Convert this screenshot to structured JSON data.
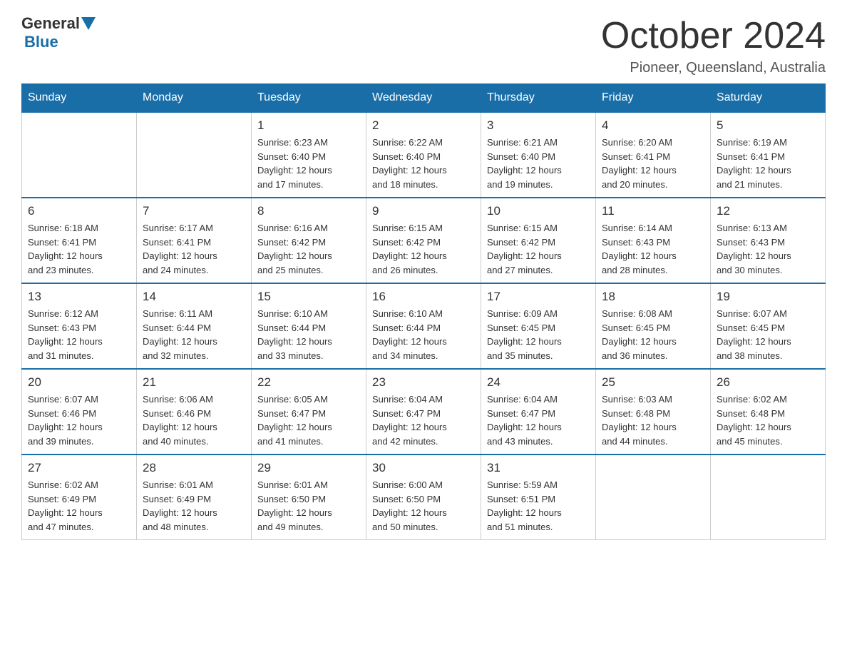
{
  "header": {
    "logo_general": "General",
    "logo_blue": "Blue",
    "month_title": "October 2024",
    "location": "Pioneer, Queensland, Australia"
  },
  "days_of_week": [
    "Sunday",
    "Monday",
    "Tuesday",
    "Wednesday",
    "Thursday",
    "Friday",
    "Saturday"
  ],
  "weeks": [
    [
      {
        "day": "",
        "info": ""
      },
      {
        "day": "",
        "info": ""
      },
      {
        "day": "1",
        "info": "Sunrise: 6:23 AM\nSunset: 6:40 PM\nDaylight: 12 hours\nand 17 minutes."
      },
      {
        "day": "2",
        "info": "Sunrise: 6:22 AM\nSunset: 6:40 PM\nDaylight: 12 hours\nand 18 minutes."
      },
      {
        "day": "3",
        "info": "Sunrise: 6:21 AM\nSunset: 6:40 PM\nDaylight: 12 hours\nand 19 minutes."
      },
      {
        "day": "4",
        "info": "Sunrise: 6:20 AM\nSunset: 6:41 PM\nDaylight: 12 hours\nand 20 minutes."
      },
      {
        "day": "5",
        "info": "Sunrise: 6:19 AM\nSunset: 6:41 PM\nDaylight: 12 hours\nand 21 minutes."
      }
    ],
    [
      {
        "day": "6",
        "info": "Sunrise: 6:18 AM\nSunset: 6:41 PM\nDaylight: 12 hours\nand 23 minutes."
      },
      {
        "day": "7",
        "info": "Sunrise: 6:17 AM\nSunset: 6:41 PM\nDaylight: 12 hours\nand 24 minutes."
      },
      {
        "day": "8",
        "info": "Sunrise: 6:16 AM\nSunset: 6:42 PM\nDaylight: 12 hours\nand 25 minutes."
      },
      {
        "day": "9",
        "info": "Sunrise: 6:15 AM\nSunset: 6:42 PM\nDaylight: 12 hours\nand 26 minutes."
      },
      {
        "day": "10",
        "info": "Sunrise: 6:15 AM\nSunset: 6:42 PM\nDaylight: 12 hours\nand 27 minutes."
      },
      {
        "day": "11",
        "info": "Sunrise: 6:14 AM\nSunset: 6:43 PM\nDaylight: 12 hours\nand 28 minutes."
      },
      {
        "day": "12",
        "info": "Sunrise: 6:13 AM\nSunset: 6:43 PM\nDaylight: 12 hours\nand 30 minutes."
      }
    ],
    [
      {
        "day": "13",
        "info": "Sunrise: 6:12 AM\nSunset: 6:43 PM\nDaylight: 12 hours\nand 31 minutes."
      },
      {
        "day": "14",
        "info": "Sunrise: 6:11 AM\nSunset: 6:44 PM\nDaylight: 12 hours\nand 32 minutes."
      },
      {
        "day": "15",
        "info": "Sunrise: 6:10 AM\nSunset: 6:44 PM\nDaylight: 12 hours\nand 33 minutes."
      },
      {
        "day": "16",
        "info": "Sunrise: 6:10 AM\nSunset: 6:44 PM\nDaylight: 12 hours\nand 34 minutes."
      },
      {
        "day": "17",
        "info": "Sunrise: 6:09 AM\nSunset: 6:45 PM\nDaylight: 12 hours\nand 35 minutes."
      },
      {
        "day": "18",
        "info": "Sunrise: 6:08 AM\nSunset: 6:45 PM\nDaylight: 12 hours\nand 36 minutes."
      },
      {
        "day": "19",
        "info": "Sunrise: 6:07 AM\nSunset: 6:45 PM\nDaylight: 12 hours\nand 38 minutes."
      }
    ],
    [
      {
        "day": "20",
        "info": "Sunrise: 6:07 AM\nSunset: 6:46 PM\nDaylight: 12 hours\nand 39 minutes."
      },
      {
        "day": "21",
        "info": "Sunrise: 6:06 AM\nSunset: 6:46 PM\nDaylight: 12 hours\nand 40 minutes."
      },
      {
        "day": "22",
        "info": "Sunrise: 6:05 AM\nSunset: 6:47 PM\nDaylight: 12 hours\nand 41 minutes."
      },
      {
        "day": "23",
        "info": "Sunrise: 6:04 AM\nSunset: 6:47 PM\nDaylight: 12 hours\nand 42 minutes."
      },
      {
        "day": "24",
        "info": "Sunrise: 6:04 AM\nSunset: 6:47 PM\nDaylight: 12 hours\nand 43 minutes."
      },
      {
        "day": "25",
        "info": "Sunrise: 6:03 AM\nSunset: 6:48 PM\nDaylight: 12 hours\nand 44 minutes."
      },
      {
        "day": "26",
        "info": "Sunrise: 6:02 AM\nSunset: 6:48 PM\nDaylight: 12 hours\nand 45 minutes."
      }
    ],
    [
      {
        "day": "27",
        "info": "Sunrise: 6:02 AM\nSunset: 6:49 PM\nDaylight: 12 hours\nand 47 minutes."
      },
      {
        "day": "28",
        "info": "Sunrise: 6:01 AM\nSunset: 6:49 PM\nDaylight: 12 hours\nand 48 minutes."
      },
      {
        "day": "29",
        "info": "Sunrise: 6:01 AM\nSunset: 6:50 PM\nDaylight: 12 hours\nand 49 minutes."
      },
      {
        "day": "30",
        "info": "Sunrise: 6:00 AM\nSunset: 6:50 PM\nDaylight: 12 hours\nand 50 minutes."
      },
      {
        "day": "31",
        "info": "Sunrise: 5:59 AM\nSunset: 6:51 PM\nDaylight: 12 hours\nand 51 minutes."
      },
      {
        "day": "",
        "info": ""
      },
      {
        "day": "",
        "info": ""
      }
    ]
  ]
}
